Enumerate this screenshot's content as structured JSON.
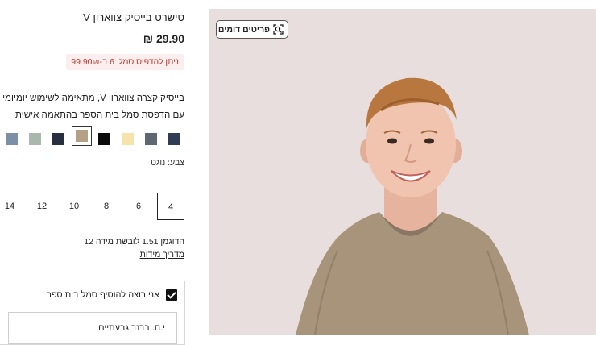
{
  "product": {
    "title": "טישרט בייסיק צווארון V",
    "price": "29.90 ₪",
    "badge_print": "ניתן להדפיס סמל",
    "badge_bulk": "6 ב-99.90₪",
    "description_line1": "בייסיק קצרה צווארון V, מתאימה לשימוש יומיומי וגם כ",
    "description_line2": "עם הדפסת סמל בית הספר בהתאמה אישית"
  },
  "colors": {
    "label": "צבע: נוגט",
    "swatches": [
      {
        "name": "navy",
        "hex": "#2e3c54"
      },
      {
        "name": "slate",
        "hex": "#5f6871"
      },
      {
        "name": "cream",
        "hex": "#f5e3a9"
      },
      {
        "name": "black",
        "hex": "#0a0a0a"
      },
      {
        "name": "nougat",
        "hex": "#b59f86",
        "selected": true
      },
      {
        "name": "dark-navy",
        "hex": "#272f40"
      },
      {
        "name": "sage",
        "hex": "#a9b8aa"
      },
      {
        "name": "steel-blue",
        "hex": "#7b8fa6"
      }
    ]
  },
  "sizes": {
    "options": [
      "4",
      "6",
      "8",
      "10",
      "12",
      "14"
    ],
    "selected": "4"
  },
  "model_note": "הדוגמן 1.51 לובשת מידה 12",
  "size_guide": "מדריך מידות",
  "addon": {
    "checkbox_label": "אני רוצה להוסיף סמל בית ספר",
    "checked": true,
    "school_value": "י.ח. ברנר גבעתיים"
  },
  "image": {
    "similar_button": "פריטים דומים",
    "similar_icon": "image-search-icon",
    "background": "#e8dedd",
    "shirt_color": "#a8937b"
  }
}
